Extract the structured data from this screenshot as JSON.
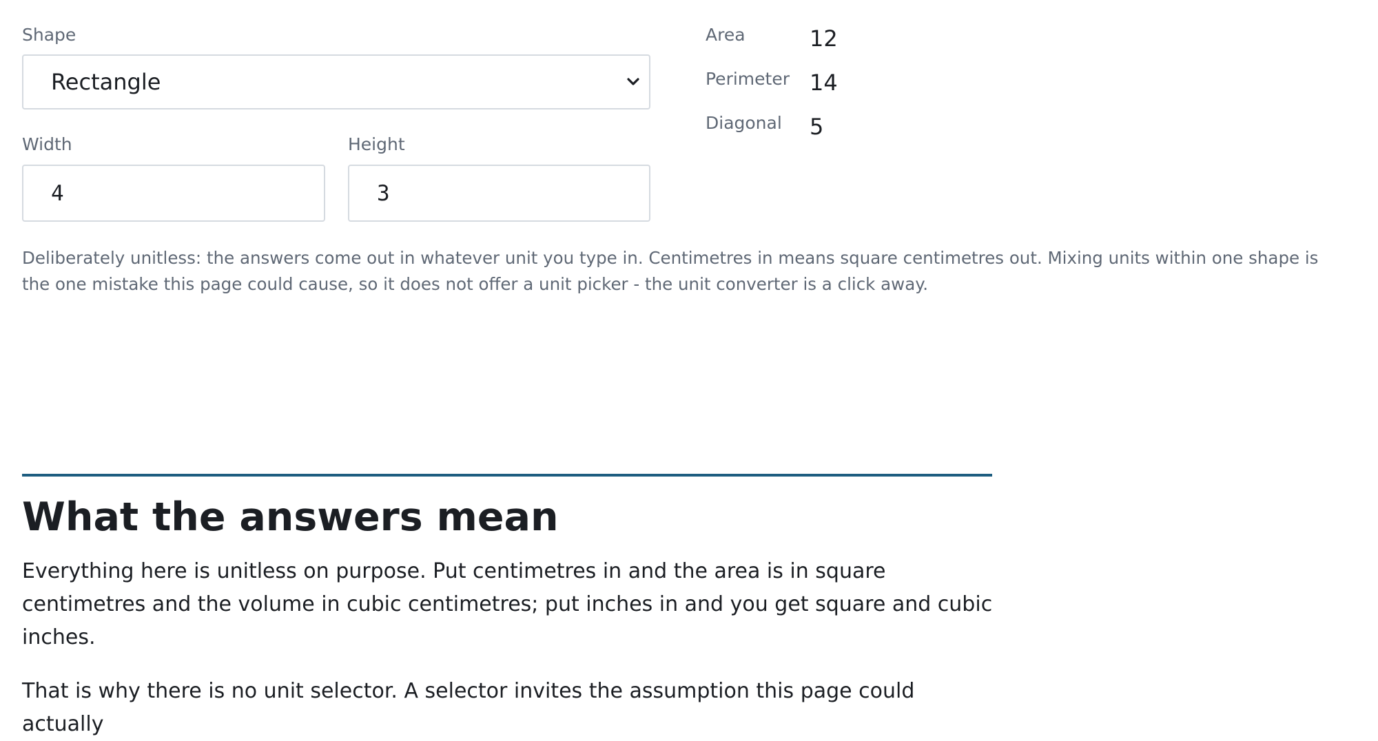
{
  "form": {
    "shape_label": "Shape",
    "shape_value": "Rectangle",
    "width_label": "Width",
    "width_value": "4",
    "height_label": "Height",
    "height_value": "3",
    "note": "Deliberately unitless: the answers come out in whatever unit you type in. Centimetres in means square centimetres out. Mixing units within one shape is the one mistake this page could cause, so it does not offer a unit picker - the unit converter is a click away."
  },
  "results": {
    "area_label": "Area",
    "area_value": "12",
    "perimeter_label": "Perimeter",
    "perimeter_value": "14",
    "diagonal_label": "Diagonal",
    "diagonal_value": "5"
  },
  "article": {
    "heading": "What the answers mean",
    "paragraph1": "Everything here is unitless on purpose. Put centimetres in and the area is in square centimetres and the volume in cubic centimetres; put inches in and you get square and cubic inches.",
    "paragraph2": "That is why there is no unit selector. A selector invites the assumption this page could actually"
  },
  "icons": {
    "shape_select_arrow": "chevron-down-icon"
  },
  "colors": {
    "accent_rule": "#1d5d80",
    "label_text": "#5f6875",
    "body_text": "#1b1e23",
    "input_border": "#d5dae0"
  }
}
